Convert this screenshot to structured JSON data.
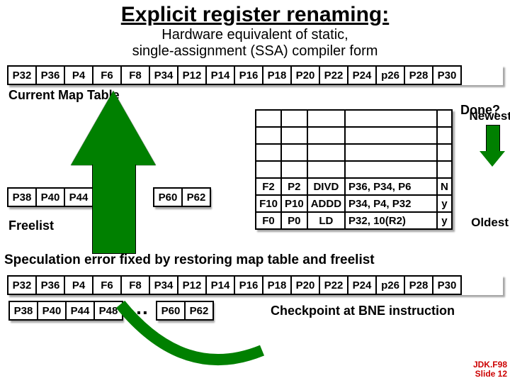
{
  "title": "Explicit register renaming:",
  "subtitle_l1": "Hardware equivalent of static,",
  "subtitle_l2": "single-assignment (SSA) compiler form",
  "map_row": [
    "P32",
    "P36",
    "P4",
    "F6",
    "F8",
    "P34",
    "P12",
    "P14",
    "P16",
    "P18",
    "P20",
    "P22",
    "P24",
    "p26",
    "P28",
    "P30"
  ],
  "cmt_label": "Current Map Table",
  "done_label": "Done?",
  "newest_label": "Newest",
  "oldest_label": "Oldest",
  "freelist1": [
    "P38",
    "P40",
    "P44"
  ],
  "freelist1b": [
    "P60",
    "P62"
  ],
  "freelist_label": "Freelist",
  "instr_rows": [
    {
      "c": [
        "",
        "",
        "",
        "",
        ""
      ]
    },
    {
      "c": [
        "",
        "",
        "",
        "",
        ""
      ]
    },
    {
      "c": [
        "",
        "",
        "",
        "",
        ""
      ]
    },
    {
      "c": [
        "",
        "",
        "",
        "",
        ""
      ]
    },
    {
      "c": [
        "F2",
        "P2",
        "DIVD",
        "P36, P34, P6",
        "N"
      ]
    },
    {
      "c": [
        "F10",
        "P10",
        "ADDD",
        "P34, P4, P32",
        "y"
      ]
    },
    {
      "c": [
        "F0",
        "P0",
        "LD",
        "P32, 10(R2)",
        "y"
      ]
    }
  ],
  "specline": "Speculation error fixed by restoring map table and freelist",
  "map_row2": [
    "P32",
    "P36",
    "P4",
    "F6",
    "F8",
    "P34",
    "P12",
    "P14",
    "P16",
    "P18",
    "P20",
    "P22",
    "P24",
    "p26",
    "P28",
    "P30"
  ],
  "freelist2a": [
    "P38",
    "P40",
    "P44",
    "P48"
  ],
  "freelist2b": [
    "P60",
    "P62"
  ],
  "checkpoint_label": "Checkpoint at BNE instruction",
  "footer_l1": "JDK.F98",
  "footer_l2": "Slide 12"
}
